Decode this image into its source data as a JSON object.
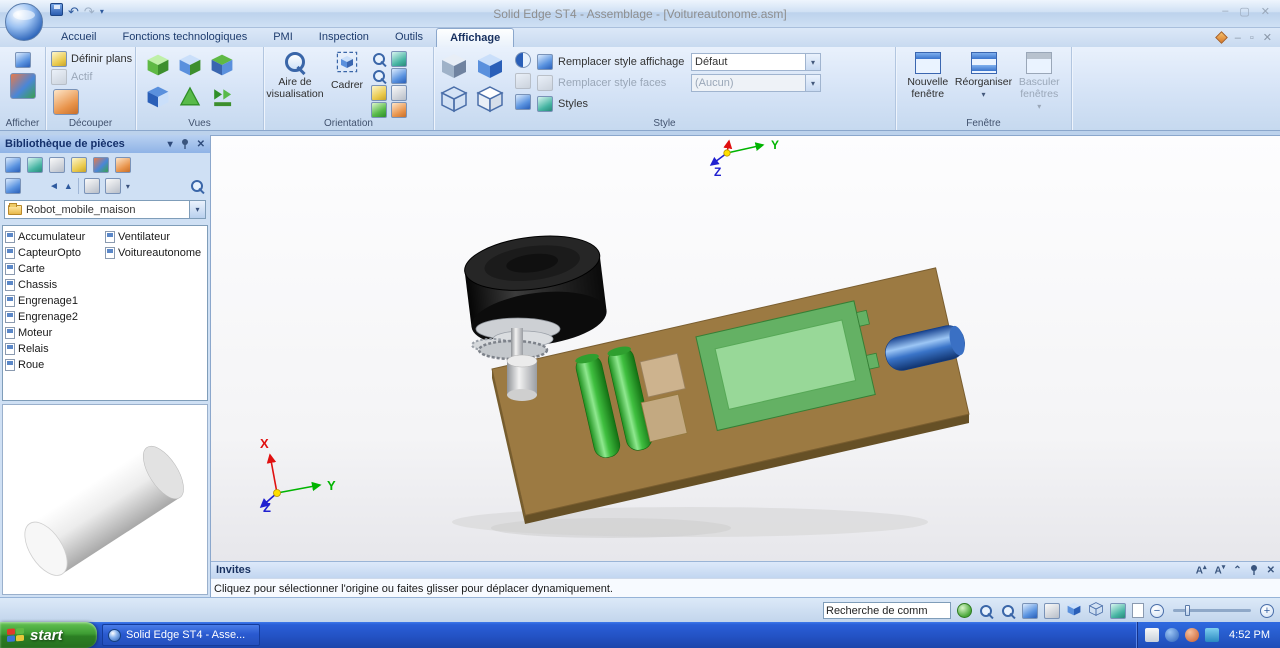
{
  "icons": {
    "dropdown": "▾",
    "close": "✕",
    "minimize": "–",
    "maximize": "▢",
    "restore": "▫",
    "undo": "↶",
    "redo": "↷",
    "back": "◄",
    "up": "▲",
    "plus": "+",
    "minus": "−",
    "chevron_up": "⌃",
    "letter_a": "A",
    "tri_up": "▴",
    "tri_down": "▾"
  },
  "titlebar": {
    "title": "Solid Edge ST4 - Assemblage - [Voitureautonome.asm]"
  },
  "tabs": [
    "Accueil",
    "Fonctions technologiques",
    "PMI",
    "Inspection",
    "Outils",
    "Affichage"
  ],
  "ribbon": {
    "afficher": {
      "label": "Afficher"
    },
    "decouper": {
      "label": "Découper",
      "definir_plans": "Définir plans",
      "actif": "Actif"
    },
    "vues": {
      "label": "Vues"
    },
    "orientation": {
      "label": "Orientation",
      "aire": "Aire de visualisation",
      "cadrer": "Cadrer"
    },
    "style": {
      "label": "Style",
      "row1": "Remplacer style affichage",
      "row2": "Remplacer style faces",
      "row3": "Styles",
      "combo1": "Défaut",
      "combo2": "(Aucun)"
    },
    "fenetre": {
      "label": "Fenêtre",
      "b1": "Nouvelle fenêtre",
      "b2": "Réorganiser",
      "b3": "Basculer fenêtres"
    }
  },
  "library": {
    "title": "Bibliothèque de pièces",
    "folder": "Robot_mobile_maison",
    "col1": [
      "Accumulateur",
      "CapteurOpto",
      "Carte",
      "Chassis",
      "Engrenage1",
      "Engrenage2",
      "Moteur",
      "Relais",
      "Roue"
    ],
    "col2": [
      "Ventilateur",
      "Voitureautonome"
    ]
  },
  "invites": {
    "title": "Invites",
    "prompt": "Cliquez pour sélectionner l'origine ou faites glisser pour déplacer dynamiquement."
  },
  "statusbar": {
    "search": "Recherche de comm"
  },
  "taskbar": {
    "start": "start",
    "task": "Solid Edge ST4 - Asse...",
    "time": "4:52 PM"
  },
  "viewport": {
    "axis_x": "X",
    "axis_y": "Y",
    "axis_z": "Z"
  }
}
